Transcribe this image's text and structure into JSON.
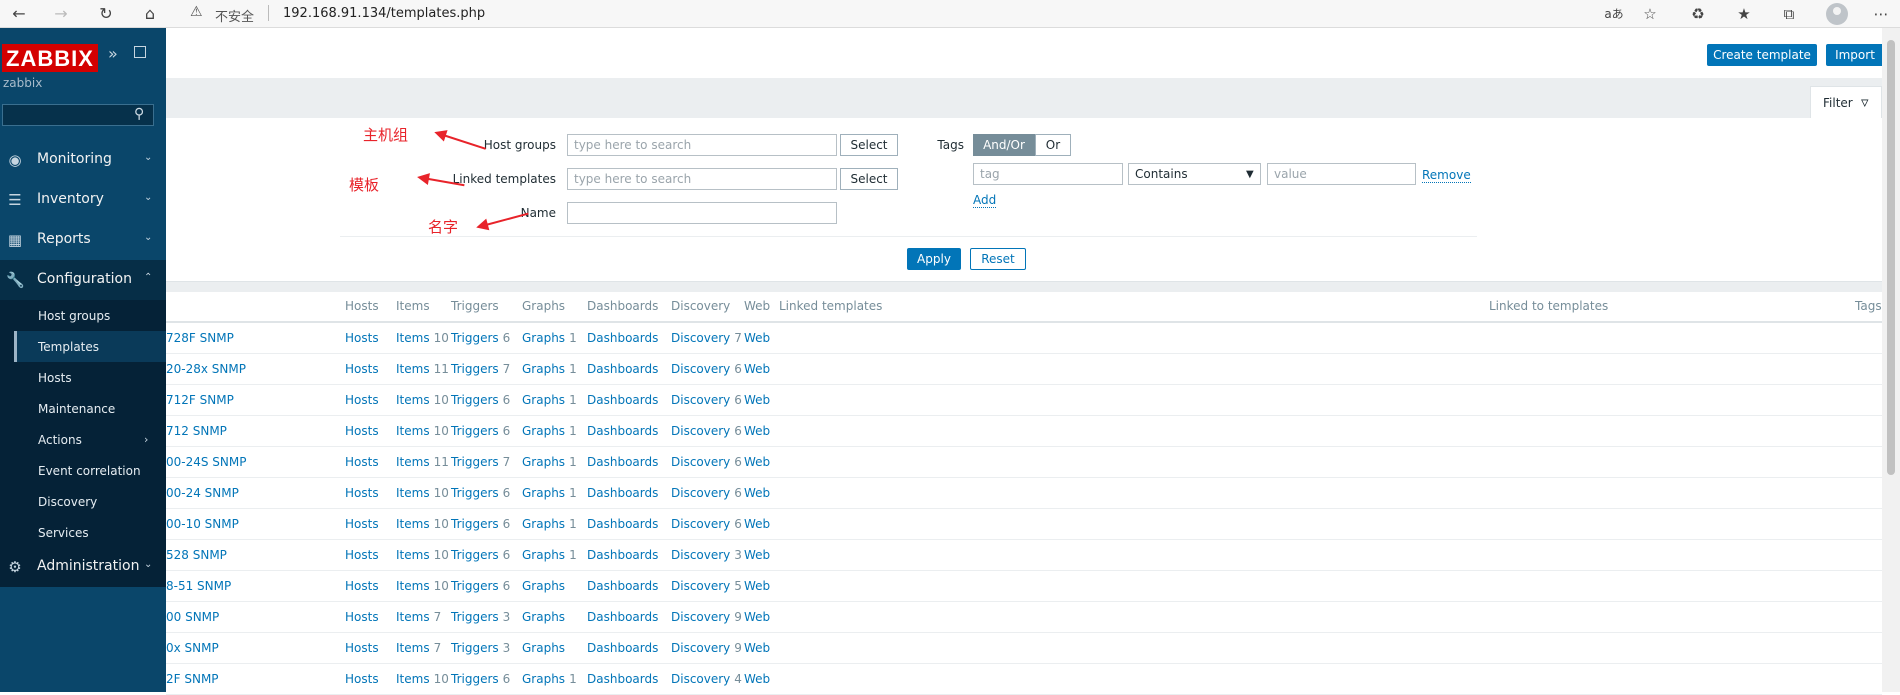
{
  "browser": {
    "security_label": "不安全",
    "url": "192.168.91.134/templates.php"
  },
  "sidebar": {
    "logo": "ZABBIX",
    "server_name": "zabbix",
    "menu": [
      {
        "label": "Monitoring",
        "icon": "eye-icon"
      },
      {
        "label": "Inventory",
        "icon": "list-icon"
      },
      {
        "label": "Reports",
        "icon": "bar-chart-icon"
      },
      {
        "label": "Configuration",
        "icon": "wrench-icon"
      },
      {
        "label": "Administration",
        "icon": "gear-icon"
      }
    ],
    "submenu": [
      {
        "label": "Host groups"
      },
      {
        "label": "Templates"
      },
      {
        "label": "Hosts"
      },
      {
        "label": "Maintenance"
      },
      {
        "label": "Actions"
      },
      {
        "label": "Event correlation"
      },
      {
        "label": "Discovery"
      },
      {
        "label": "Services"
      }
    ]
  },
  "header": {
    "create_template": "Create template",
    "import": "Import"
  },
  "filter": {
    "tab_label": "Filter",
    "host_groups_label": "Host groups",
    "host_groups_placeholder": "type here to search",
    "linked_templates_label": "Linked templates",
    "linked_templates_placeholder": "type here to search",
    "name_label": "Name",
    "name_value": "",
    "select_label": "Select",
    "tags_label": "Tags",
    "tags_andor": "And/Or",
    "tags_or": "Or",
    "tag_placeholder": "tag",
    "operator_value": "Contains",
    "value_placeholder": "value",
    "remove_label": "Remove",
    "add_label": "Add",
    "apply_label": "Apply",
    "reset_label": "Reset"
  },
  "annotations": {
    "host_groups": "主机组",
    "templates": "模板",
    "name": "名字"
  },
  "table": {
    "headers": {
      "hosts": "Hosts",
      "items": "Items",
      "triggers": "Triggers",
      "graphs": "Graphs",
      "dashboards": "Dashboards",
      "discovery": "Discovery",
      "web": "Web",
      "linked_templates": "Linked templates",
      "linked_to_templates": "Linked to templates",
      "tags": "Tags"
    },
    "rows": [
      {
        "name": "728F SNMP",
        "hosts": "Hosts",
        "items": "Items",
        "items_n": "10",
        "triggers": "Triggers",
        "triggers_n": "6",
        "graphs": "Graphs",
        "graphs_n": "1",
        "dashboards": "Dashboards",
        "discovery": "Discovery",
        "discovery_n": "7",
        "web": "Web"
      },
      {
        "name": "20-28x SNMP",
        "hosts": "Hosts",
        "items": "Items",
        "items_n": "11",
        "triggers": "Triggers",
        "triggers_n": "7",
        "graphs": "Graphs",
        "graphs_n": "1",
        "dashboards": "Dashboards",
        "discovery": "Discovery",
        "discovery_n": "6",
        "web": "Web"
      },
      {
        "name": "712F SNMP",
        "hosts": "Hosts",
        "items": "Items",
        "items_n": "10",
        "triggers": "Triggers",
        "triggers_n": "6",
        "graphs": "Graphs",
        "graphs_n": "1",
        "dashboards": "Dashboards",
        "discovery": "Discovery",
        "discovery_n": "6",
        "web": "Web"
      },
      {
        "name": "712 SNMP",
        "hosts": "Hosts",
        "items": "Items",
        "items_n": "10",
        "triggers": "Triggers",
        "triggers_n": "6",
        "graphs": "Graphs",
        "graphs_n": "1",
        "dashboards": "Dashboards",
        "discovery": "Discovery",
        "discovery_n": "6",
        "web": "Web"
      },
      {
        "name": "00-24S SNMP",
        "hosts": "Hosts",
        "items": "Items",
        "items_n": "11",
        "triggers": "Triggers",
        "triggers_n": "7",
        "graphs": "Graphs",
        "graphs_n": "1",
        "dashboards": "Dashboards",
        "discovery": "Discovery",
        "discovery_n": "6",
        "web": "Web"
      },
      {
        "name": "00-24 SNMP",
        "hosts": "Hosts",
        "items": "Items",
        "items_n": "10",
        "triggers": "Triggers",
        "triggers_n": "6",
        "graphs": "Graphs",
        "graphs_n": "1",
        "dashboards": "Dashboards",
        "discovery": "Discovery",
        "discovery_n": "6",
        "web": "Web"
      },
      {
        "name": "00-10 SNMP",
        "hosts": "Hosts",
        "items": "Items",
        "items_n": "10",
        "triggers": "Triggers",
        "triggers_n": "6",
        "graphs": "Graphs",
        "graphs_n": "1",
        "dashboards": "Dashboards",
        "discovery": "Discovery",
        "discovery_n": "6",
        "web": "Web"
      },
      {
        "name": "528 SNMP",
        "hosts": "Hosts",
        "items": "Items",
        "items_n": "10",
        "triggers": "Triggers",
        "triggers_n": "6",
        "graphs": "Graphs",
        "graphs_n": "1",
        "dashboards": "Dashboards",
        "discovery": "Discovery",
        "discovery_n": "3",
        "web": "Web"
      },
      {
        "name": "8-51 SNMP",
        "hosts": "Hosts",
        "items": "Items",
        "items_n": "10",
        "triggers": "Triggers",
        "triggers_n": "6",
        "graphs": "Graphs",
        "graphs_n": "",
        "dashboards": "Dashboards",
        "discovery": "Discovery",
        "discovery_n": "5",
        "web": "Web"
      },
      {
        "name": "00 SNMP",
        "hosts": "Hosts",
        "items": "Items",
        "items_n": "7",
        "triggers": "Triggers",
        "triggers_n": "3",
        "graphs": "Graphs",
        "graphs_n": "",
        "dashboards": "Dashboards",
        "discovery": "Discovery",
        "discovery_n": "9",
        "web": "Web"
      },
      {
        "name": "0x SNMP",
        "hosts": "Hosts",
        "items": "Items",
        "items_n": "7",
        "triggers": "Triggers",
        "triggers_n": "3",
        "graphs": "Graphs",
        "graphs_n": "",
        "dashboards": "Dashboards",
        "discovery": "Discovery",
        "discovery_n": "9",
        "web": "Web"
      },
      {
        "name": "2F SNMP",
        "hosts": "Hosts",
        "items": "Items",
        "items_n": "10",
        "triggers": "Triggers",
        "triggers_n": "6",
        "graphs": "Graphs",
        "graphs_n": "1",
        "dashboards": "Dashboards",
        "discovery": "Discovery",
        "discovery_n": "4",
        "web": "Web"
      }
    ]
  },
  "colors": {
    "sidebar_bg": "#0a466a",
    "accent": "#0275b8",
    "annotation": "#e8232a",
    "logo": "#d40000"
  }
}
